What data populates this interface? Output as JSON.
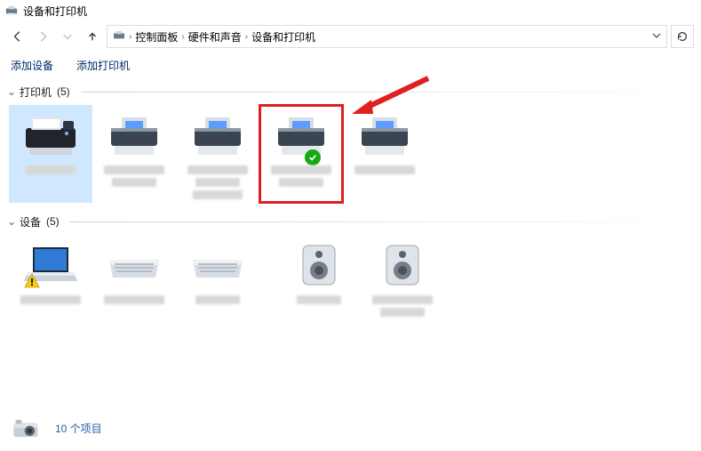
{
  "window": {
    "title": "设备和打印机"
  },
  "breadcrumbs": {
    "root": "控制面板",
    "mid": "硬件和声音",
    "leaf": "设备和打印机"
  },
  "toolbar": {
    "add_device": "添加设备",
    "add_printer": "添加打印机"
  },
  "sections": {
    "printers": {
      "label": "打印机",
      "count": "(5)",
      "caret": "⌄"
    },
    "devices": {
      "label": "设备",
      "count": "(5)",
      "caret": "⌄"
    }
  },
  "status": {
    "count_text": "10 个项目"
  }
}
